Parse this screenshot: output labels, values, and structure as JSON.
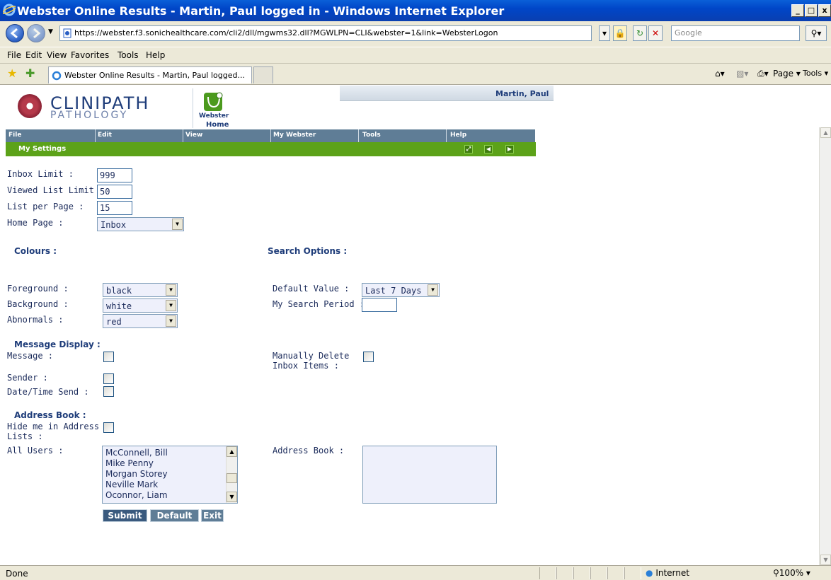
{
  "window": {
    "title": "Webster Online Results - Martin, Paul logged in - Windows Internet Explorer",
    "min": "_",
    "max": "□",
    "close": "x"
  },
  "browser": {
    "url": "https://webster.f3.sonichealthcare.com/cli2/dll/mgwms32.dll?MGWLPN=CLI&webster=1&link=WebsterLogon",
    "search_placeholder": "Google",
    "menu": [
      "File",
      "Edit",
      "View",
      "Favorites",
      "Tools",
      "Help"
    ],
    "tab_title": "Webster Online Results - Martin, Paul logged...",
    "page_label": "Page ▾",
    "tools_label": "Tools ▾",
    "status_text": "Done",
    "zone": "Internet",
    "zoom": "100%"
  },
  "app": {
    "logo_line1": "CLINIPATH",
    "logo_line2": "PATHOLOGY",
    "webster_name": "Webster",
    "home_label": "Home",
    "user": "Martin, Paul",
    "menu": [
      "File",
      "Edit",
      "View",
      "My Webster",
      "Tools",
      "Help"
    ],
    "section_title": "My Settings"
  },
  "settings": {
    "inbox_limit_label": "Inbox Limit :",
    "inbox_limit": "999",
    "viewed_limit_label": "Viewed List Limit :",
    "viewed_limit": "50",
    "list_per_page_label": "List per Page :",
    "list_per_page": "15",
    "home_page_label": "Home Page :",
    "home_page": "Inbox",
    "colours_heading": "Colours :",
    "foreground_label": "Foreground :",
    "foreground": "black",
    "background_label": "Background :",
    "background": "white",
    "abnormals_label": "Abnormals :",
    "abnormals": "red",
    "search_heading": "Search Options :",
    "default_value_label": "Default Value :",
    "default_value": "Last 7 Days",
    "search_period_label": "My Search Period :",
    "message_heading": "Message Display :",
    "message_label": "Message :",
    "sender_label": "Sender :",
    "datetime_label": "Date/Time Send :",
    "manual_delete_label_1": "Manually Delete",
    "manual_delete_label_2": "Inbox Items :",
    "address_heading": "Address Book :",
    "hide_me_label_1": "Hide me in Address",
    "hide_me_label_2": "Lists :",
    "all_users_label": "All Users :",
    "address_book_label": "Address Book :",
    "all_users": [
      "McConnell, Bill",
      "Mike Penny",
      "Morgan Storey",
      "Neville Mark",
      "Oconnor, Liam"
    ],
    "submit": "Submit",
    "default": "Default",
    "exit": "Exit"
  }
}
